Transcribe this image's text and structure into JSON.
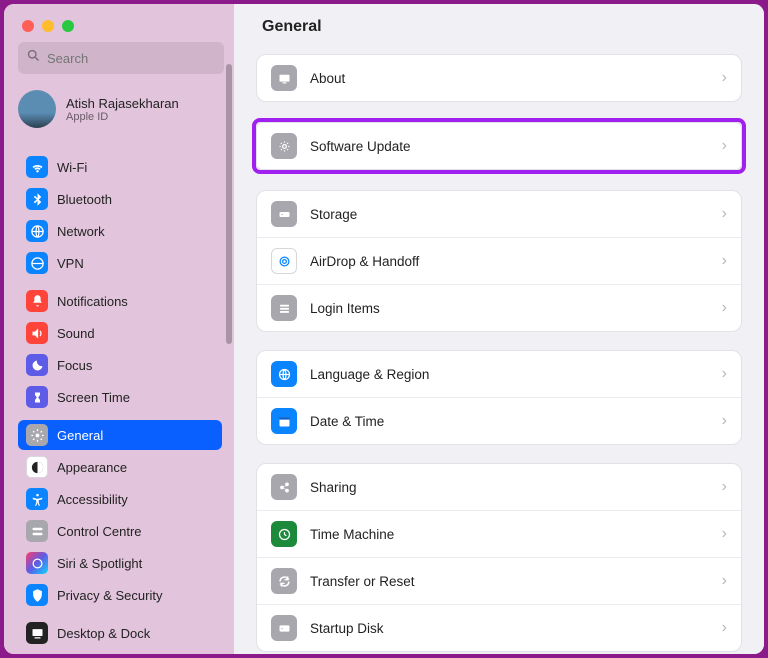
{
  "search": {
    "placeholder": "Search"
  },
  "user": {
    "name": "Atish Rajasekharan",
    "sub": "Apple ID"
  },
  "sidebar": {
    "items": [
      {
        "label": "Wi-Fi"
      },
      {
        "label": "Bluetooth"
      },
      {
        "label": "Network"
      },
      {
        "label": "VPN"
      },
      {
        "label": "Notifications"
      },
      {
        "label": "Sound"
      },
      {
        "label": "Focus"
      },
      {
        "label": "Screen Time"
      },
      {
        "label": "General"
      },
      {
        "label": "Appearance"
      },
      {
        "label": "Accessibility"
      },
      {
        "label": "Control Centre"
      },
      {
        "label": "Siri & Spotlight"
      },
      {
        "label": "Privacy & Security"
      },
      {
        "label": "Desktop & Dock"
      }
    ]
  },
  "main": {
    "title": "General",
    "groups": [
      {
        "rows": [
          {
            "label": "About"
          }
        ]
      },
      {
        "highlight": true,
        "rows": [
          {
            "label": "Software Update"
          }
        ]
      },
      {
        "rows": [
          {
            "label": "Storage"
          },
          {
            "label": "AirDrop & Handoff"
          },
          {
            "label": "Login Items"
          }
        ]
      },
      {
        "rows": [
          {
            "label": "Language & Region"
          },
          {
            "label": "Date & Time"
          }
        ]
      },
      {
        "rows": [
          {
            "label": "Sharing"
          },
          {
            "label": "Time Machine"
          },
          {
            "label": "Transfer or Reset"
          },
          {
            "label": "Startup Disk"
          }
        ]
      }
    ]
  }
}
